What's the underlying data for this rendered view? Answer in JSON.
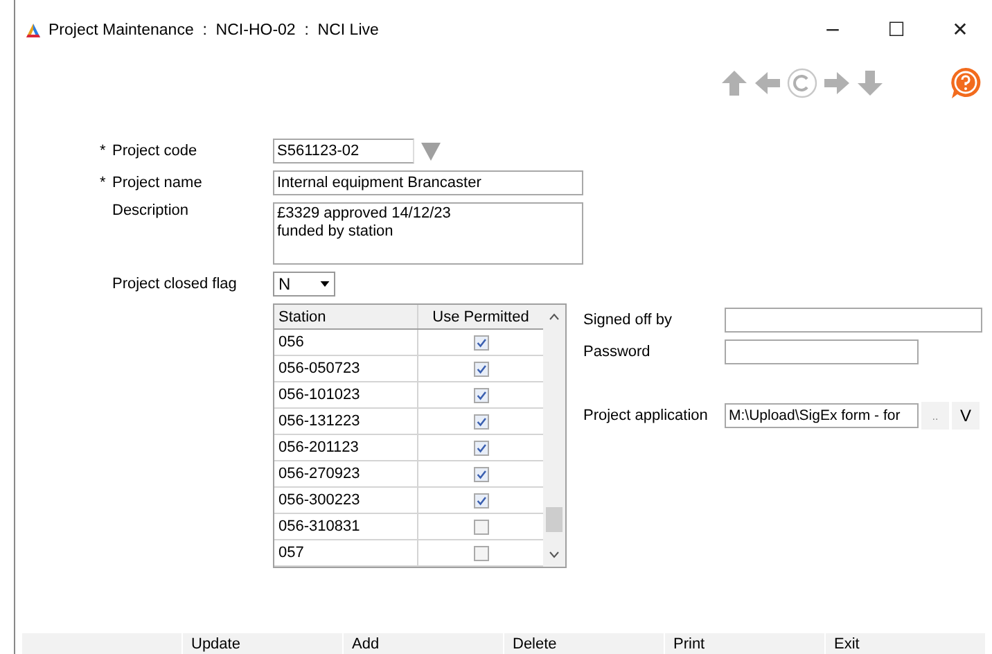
{
  "window": {
    "title": "Project Maintenance  :  NCI-HO-02  :  NCI Live",
    "controls": [
      "−",
      "☐",
      "✕"
    ]
  },
  "project_code": {
    "required_mark": "*",
    "label": "Project code",
    "value": "S561123-02"
  },
  "project_name": {
    "required_mark": "*",
    "label": "Project name",
    "value": "Internal equipment Brancaster"
  },
  "description": {
    "label": "Description",
    "value": "£3329 approved 14/12/23\nfunded by station"
  },
  "project_closed_flag": {
    "label": "Project closed flag",
    "value": "N"
  },
  "stations": {
    "columns": [
      "Station",
      "Use Permitted"
    ],
    "rows": [
      {
        "station": "056",
        "checked": true
      },
      {
        "station": "056-050723",
        "checked": true
      },
      {
        "station": "056-101023",
        "checked": true
      },
      {
        "station": "056-131223",
        "checked": true
      },
      {
        "station": "056-201123",
        "checked": true
      },
      {
        "station": "056-270923",
        "checked": true
      },
      {
        "station": "056-300223",
        "checked": true
      },
      {
        "station": "056-310831",
        "checked": false
      },
      {
        "station": "057",
        "checked": false
      }
    ]
  },
  "signed_off_by": {
    "label": "Signed off by"
  },
  "password": {
    "label": "Password"
  },
  "project_application": {
    "label": "Project application",
    "value": "M:\\Upload\\SigEx form - for",
    "browse": "..",
    "view": "V"
  },
  "buttons": [
    "Update",
    "Add",
    "Delete",
    "Print",
    "Exit"
  ]
}
